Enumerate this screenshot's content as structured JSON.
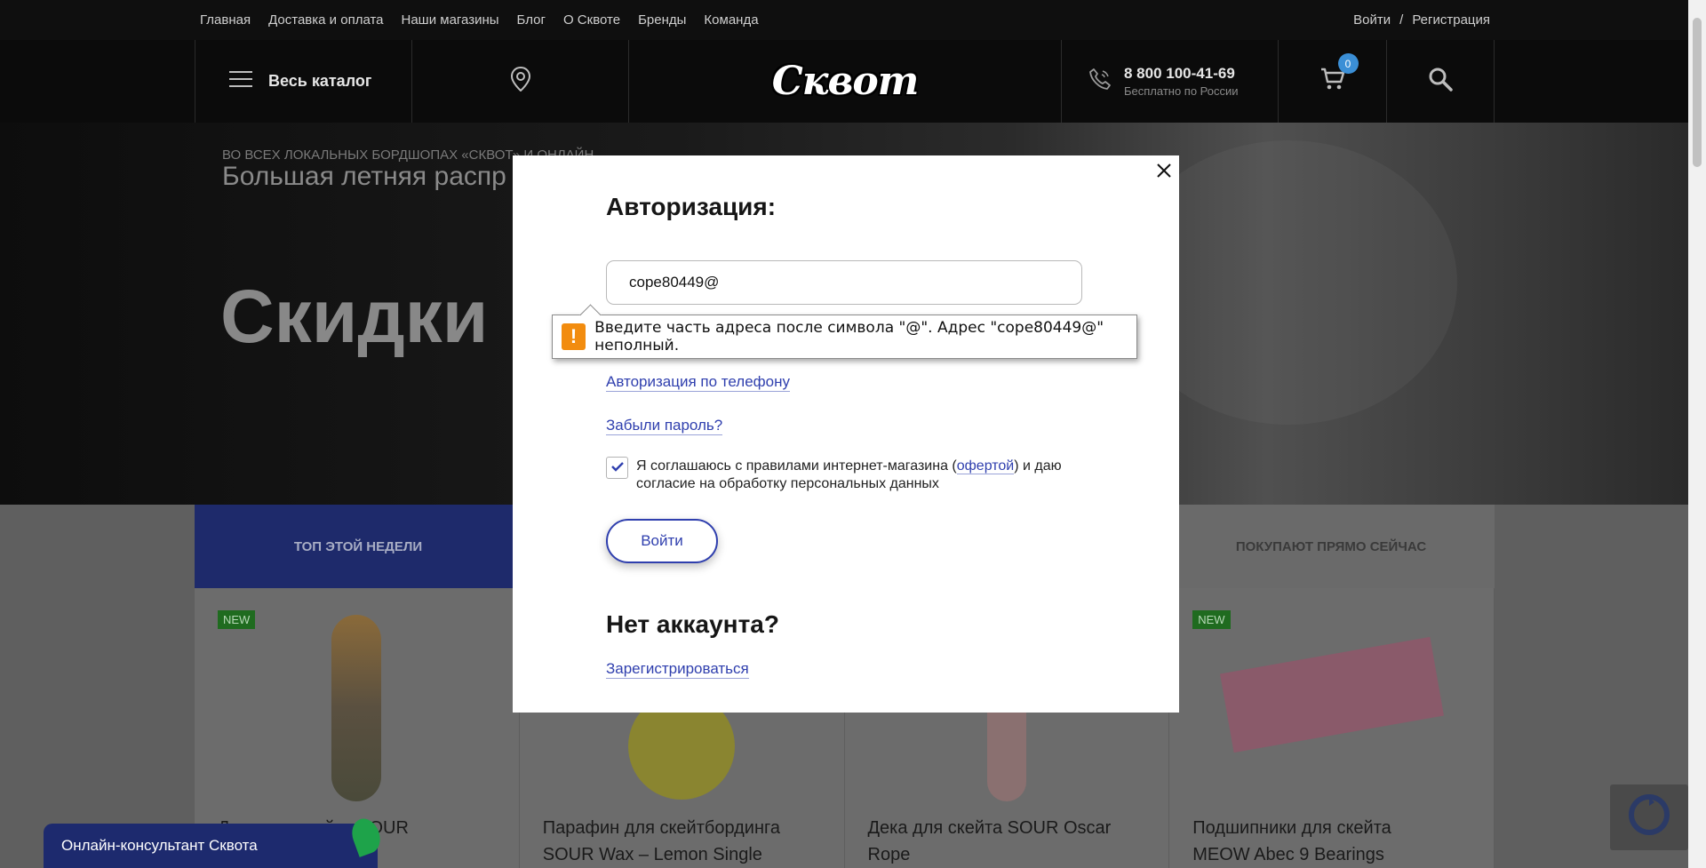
{
  "topnav": {
    "links": [
      "Главная",
      "Доставка и оплата",
      "Наши магазины",
      "Блог",
      "О Сквоте",
      "Бренды",
      "Команда"
    ],
    "login": "Войти",
    "separator": "/",
    "register": "Регистрация"
  },
  "header": {
    "catalog_label": "Весь каталог",
    "logo_text": "Сквот",
    "phone": "8 800 100-41-69",
    "phone_note": "Бесплатно по России",
    "cart_count": "0"
  },
  "hero": {
    "pretitle": "ВО ВСЕХ ЛОКАЛЬНЫХ БОРДШОПАХ «СКВОТ» И ОНЛАЙН",
    "title": "Большая летняя распр",
    "big": "Скидки"
  },
  "tabs": {
    "left": "ТОП ЭТОЙ НЕДЕЛИ",
    "right": "ПОКУПАЮТ ПРЯМО СЕЙЧАС"
  },
  "products": [
    {
      "badge": "NEW",
      "name": "Дека для скейта SOUR"
    },
    {
      "badge": "",
      "name": "Парафин для скейтбординга SOUR Wax – Lemon Single"
    },
    {
      "badge": "",
      "name": "Дека для скейта SOUR Oscar Rope"
    },
    {
      "badge": "NEW",
      "name": "Подшипники для скейта MEOW Abec 9 Bearings"
    }
  ],
  "chat": {
    "label": "Онлайн-консультант Сквота"
  },
  "modal": {
    "title": "Авторизация:",
    "email_value": "cope80449@",
    "phone_auth": "Авторизация по телефону",
    "forgot": "Забыли пароль?",
    "agree_prefix": "Я соглашаюсь с правилами интернет-магазина (",
    "agree_link": "офертой",
    "agree_suffix": ") и даю согласие на обработку персональных данных",
    "agree_checked": true,
    "login_button": "Войти",
    "no_account": "Нет аккаунта?",
    "register": "Зарегистрироваться"
  },
  "tooltip": {
    "text": "Введите часть адреса после символа \"@\". Адрес \"cope80449@\" неполный."
  },
  "colors": {
    "accent": "#2f3fae",
    "warning": "#f28c0f",
    "cart_badge": "#3b8fd6",
    "new_badge": "#1f6b1f"
  }
}
